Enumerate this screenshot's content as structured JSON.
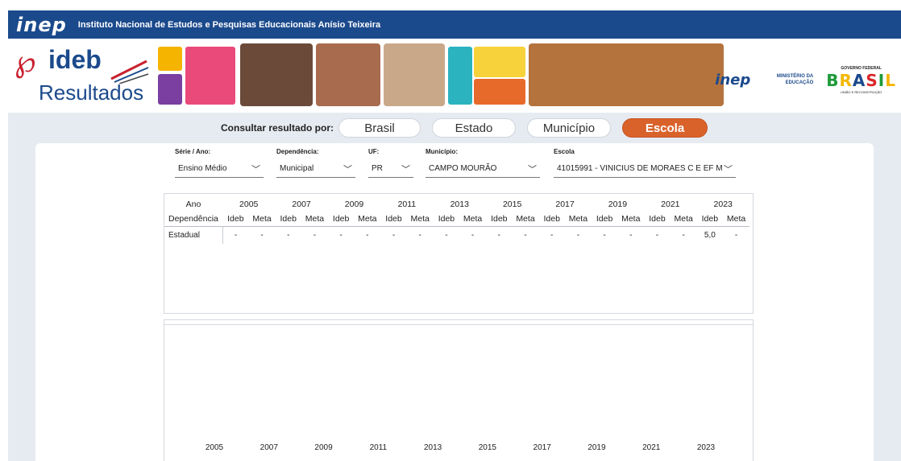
{
  "header": {
    "logo": "inep",
    "title": "Instituto Nacional de Estudos e Pesquisas Educacionais Anísio Teixeira"
  },
  "banner": {
    "brand": "ideb",
    "subtitle": "Resultados",
    "partner_logo": "inep",
    "ministry": "MINISTÉRIO DA EDUCAÇÃO",
    "gov_top": "GOVERNO FEDERAL",
    "gov_word": "BRASIL",
    "gov_bottom": "UNIÃO E RECONSTRUÇÃO"
  },
  "consult": {
    "label": "Consultar resultado por:",
    "options": [
      "Brasil",
      "Estado",
      "Município",
      "Escola"
    ],
    "selected": "Escola"
  },
  "filters": {
    "serie": {
      "label": "Série / Ano:",
      "value": "Ensino Médio"
    },
    "dependencia": {
      "label": "Dependência:",
      "value": "Municipal"
    },
    "uf": {
      "label": "UF:",
      "value": "PR"
    },
    "municipio": {
      "label": "Município:",
      "value": "CAMPO MOURÃO"
    },
    "escola": {
      "label": "Escola",
      "value": "41015991 - VINICIUS DE MORAES C E EF M"
    }
  },
  "table": {
    "year_label": "Ano",
    "dep_label": "Dependência",
    "years": [
      "2005",
      "2007",
      "2009",
      "2011",
      "2013",
      "2015",
      "2017",
      "2019",
      "2021",
      "2023"
    ],
    "col_ideb": "Ideb",
    "col_meta": "Meta",
    "rows": [
      {
        "label": "Estadual",
        "cells": [
          "-",
          "-",
          "-",
          "-",
          "-",
          "-",
          "-",
          "-",
          "-",
          "-",
          "-",
          "-",
          "-",
          "-",
          "-",
          "-",
          "-",
          "-",
          "5,0",
          "-"
        ]
      }
    ]
  },
  "chart": {
    "x_ticks": [
      "2005",
      "2007",
      "2009",
      "2011",
      "2013",
      "2015",
      "2017",
      "2019",
      "2021",
      "2023"
    ]
  },
  "colors": {
    "brand_blue": "#1b4a8c",
    "accent_orange": "#d9622b",
    "ideb_red": "#c8202e"
  }
}
